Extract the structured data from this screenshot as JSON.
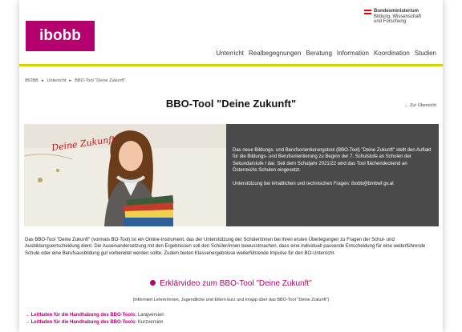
{
  "header": {
    "logo_text": "ibobb",
    "ministry_lines": [
      "Bundesministerium",
      "Bildung, Wissenschaft",
      "und Forschung"
    ],
    "nav": [
      "Unterricht",
      "Realbegegnungen",
      "Beratung",
      "Information",
      "Koordination",
      "Studien"
    ]
  },
  "breadcrumb": [
    "IBOBB",
    "Unterricht",
    "BBO-Tool \"Deine Zukunft\""
  ],
  "title": "BBO-Tool \"Deine Zukunft\"",
  "back_link": "← Zur Übersicht",
  "hero": {
    "image_caption": "Deine Zukunft",
    "para1": "Das neue Bildungs- und Berufsorientierungstool (BBO-Tool) \"Deine Zukunft\" stellt den Auftakt für die Bildungs- und Berufsorientierung zu Beginn der 7. Schulstufe an Schulen der Sekundarstufe I dar. Seit dem Schuljahr 2021/22 wird das Tool flächendeckend an Österreichs Schulen eingesetzt.",
    "para2": "Unterstützung bei inhaltlichen und technischen Fragen: ibobb@bmbwf.gv.at"
  },
  "intro": "Das BBO-Tool \"Deine Zukunft\" (vormals BO-Tool) ist ein Online-Instrument, das der Unterstützung der Schüler/innen bei ihren ersten Überlegungen zu Fragen der Schul- und Ausbildungsentscheidung dient. Die Auseinandersetzung mit den Ergebnissen soll den Schüler/innen bewusstmachen, dass eine individuell passende Entscheidung für eine weiterführende Schule oder eine Berufsausbildung gut vorbereitet werden sollte. Zudem bieten Klassenergebnisse weiterführende Impulse für den BO-Unterricht.",
  "video": {
    "label": "Erklärvideo zum BBO-Tool \"Deine Zukunft\"",
    "sub": "(informiert Lehrer/innen, Jugendliche und Eltern kurz und knapp über das BBO-Tool \"Deine Zukunft\")"
  },
  "docs": [
    {
      "link": "→ Leitfaden für die Handhabung des BBO-Tools:",
      "rest": " Langversion"
    },
    {
      "link": "→ Leitfaden für die Handhabung des BBO-Tools:",
      "rest": " Kurzversion"
    }
  ],
  "colors": {
    "brand": "#b4006e",
    "accent": "#cdd400",
    "hero_bg": "#4a4a4a"
  }
}
